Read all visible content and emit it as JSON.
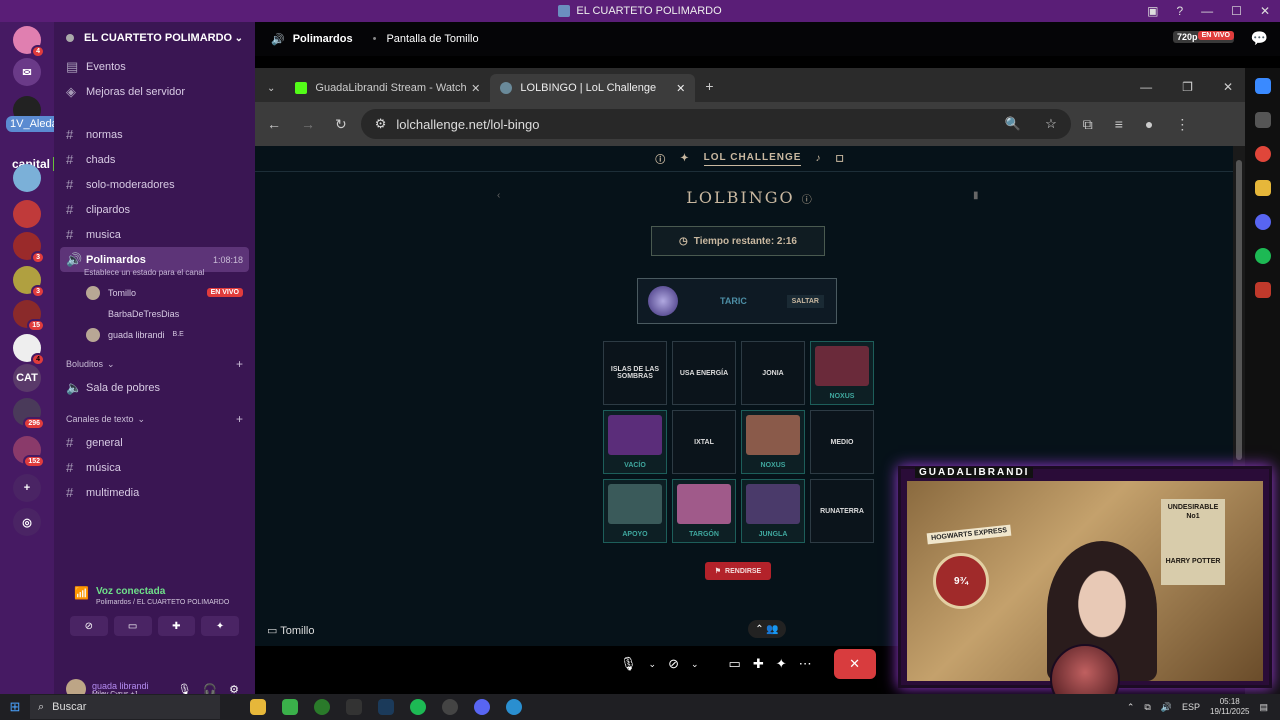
{
  "window_title": "EL CUARTETO POLIMARDO",
  "server": {
    "name": "EL CUARTETO POLIMARDO"
  },
  "rail": {
    "overlay_user": "1V_Aledark19",
    "overlay_capital": "capital",
    "cat_label": "CAT",
    "badges": [
      "4",
      "3",
      "3",
      "15",
      "4",
      "296",
      "152"
    ]
  },
  "channels": {
    "top": [
      {
        "label": "Eventos"
      },
      {
        "label": "Mejoras del servidor"
      }
    ],
    "text": [
      {
        "label": "normas"
      },
      {
        "label": "chads"
      },
      {
        "label": "solo-moderadores"
      },
      {
        "label": "clipardos"
      },
      {
        "label": "musica"
      }
    ],
    "active_voice": {
      "label": "Polimardos",
      "time": "1:08:18",
      "status": "Establece un estado para el canal"
    },
    "members": [
      {
        "name": "Tomillo",
        "live": "EN VIVO"
      },
      {
        "name": "BarbaDeTresDias"
      },
      {
        "name": "guada librandi",
        "tag": "B.E"
      }
    ],
    "cat1": {
      "label": "Boluditos"
    },
    "cat1_items": [
      {
        "label": "Sala de pobres"
      }
    ],
    "cat2": {
      "label": "Canales de texto"
    },
    "cat2_items": [
      {
        "label": "general"
      },
      {
        "label": "música"
      },
      {
        "label": "multimedia"
      }
    ]
  },
  "voice": {
    "status": "Voz conectada",
    "location": "Polimardos / EL CUARTETO POLIMARDO"
  },
  "user": {
    "name": "guada librandi",
    "activity": "Miley Cyrus +1"
  },
  "stream": {
    "channel": "Polimardos",
    "title": "Pantalla de Tomillo",
    "quality": "720p 30 FPS",
    "live": "EN VIVO"
  },
  "browser": {
    "tabs": [
      {
        "title": "GuadaLibrandi Stream - Watch"
      },
      {
        "title": "LOLBINGO | LoL Challenge"
      }
    ],
    "url": "lolchallenge.net/lol-bingo"
  },
  "page": {
    "header": "LOL CHALLENGE",
    "title": "LOLBINGO",
    "timer": "Tiempo restante: 2:16",
    "champion": "TARIC",
    "skip": "SALTAR",
    "cells": [
      {
        "label": "ISLAS DE LAS SOMBRAS",
        "hit": false
      },
      {
        "label": "USA ENERGÍA",
        "hit": false
      },
      {
        "label": "JONIA",
        "hit": false
      },
      {
        "label": "NOXUS",
        "hit": true,
        "color": "#6a2a3a"
      },
      {
        "label": "VACÍO",
        "hit": true,
        "color": "#5b2d7a"
      },
      {
        "label": "IXTAL",
        "hit": false
      },
      {
        "label": "NOXUS",
        "hit": true,
        "color": "#8a5a4a"
      },
      {
        "label": "MEDIO",
        "hit": false
      },
      {
        "label": "APOYO",
        "hit": true,
        "color": "#3a5a5a"
      },
      {
        "label": "TARGÓN",
        "hit": true,
        "color": "#a05a8a"
      },
      {
        "label": "JUNGLA",
        "hit": true,
        "color": "#4a3a6a"
      },
      {
        "label": "RUNATERRA",
        "hit": false
      }
    ],
    "surrender": "RENDIRSE"
  },
  "call": {
    "presenter": "Tomillo"
  },
  "cam": {
    "label": "GUADALIBRANDI",
    "poster": "UNDESIRABLE No1",
    "poster_name": "HARRY POTTER",
    "platform": "9¾",
    "hogwarts": "HOGWARTS EXPRESS"
  },
  "taskbar": {
    "search": "Buscar",
    "lang": "ESP",
    "time": "05:18",
    "date": "19/11/2025"
  }
}
